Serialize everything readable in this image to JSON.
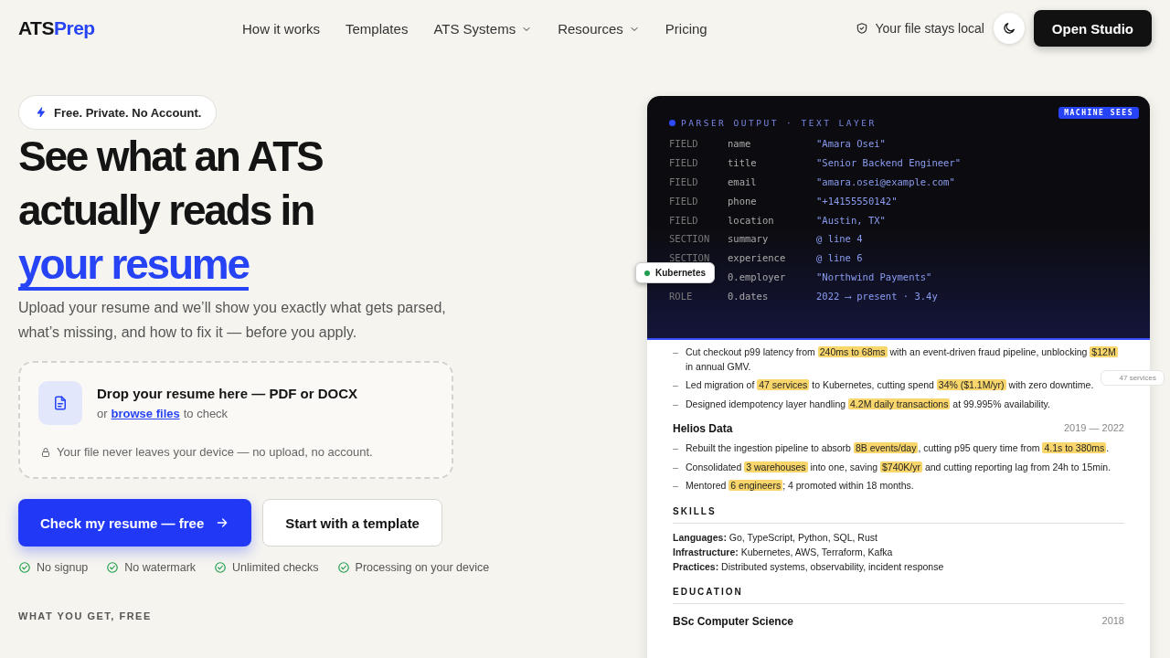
{
  "nav": {
    "logo": {
      "part_1": "ATS",
      "part_2": "Prep"
    },
    "links": [
      {
        "label": "How it works",
        "dropdown": false
      },
      {
        "label": "Templates",
        "dropdown": false
      },
      {
        "label": "ATS Systems",
        "dropdown": true
      },
      {
        "label": "Resources",
        "dropdown": true
      },
      {
        "label": "Pricing",
        "dropdown": false
      }
    ],
    "local_note": "Your file stays local",
    "cta": "Open Studio"
  },
  "hero": {
    "badge": "Free. Private. No Account.",
    "headline_lines": [
      "See what an ATS",
      "actually reads in"
    ],
    "headline_accent": "your resume",
    "subtitle": "Upload your resume and we’ll show you exactly what gets parsed, what’s missing, and how to fix it — before you apply.",
    "dropzone": {
      "title": "Drop your resume here — PDF or DOCX",
      "prefix": "or",
      "link": "browse files",
      "suffix": "to check",
      "privacy": "Your file never leaves your device — no upload, no account."
    },
    "primary_button": "Check my resume — free",
    "secondary_button": "Start with a template",
    "perks": [
      "No signup",
      "No watermark",
      "Unlimited checks",
      "Processing on your device"
    ],
    "section_label": "WHAT YOU GET, FREE"
  },
  "preview": {
    "header": "PARSER OUTPUT · TEXT LAYER",
    "tag": "MACHINE SEES",
    "rows": [
      {
        "kind": "FIELD",
        "key": "name",
        "value": "\"Amara Osei\""
      },
      {
        "kind": "FIELD",
        "key": "title",
        "value": "\"Senior Backend Engineer\""
      },
      {
        "kind": "FIELD",
        "key": "email",
        "value": "\"amara.osei@example.com\""
      },
      {
        "kind": "FIELD",
        "key": "phone",
        "value": "\"+14155550142\""
      },
      {
        "kind": "FIELD",
        "key": "location",
        "value": "\"Austin, TX\""
      },
      {
        "kind": "SECTION",
        "key": "summary",
        "value": "@ line 4"
      },
      {
        "kind": "SECTION",
        "key": "experience",
        "value": "@ line 6"
      },
      {
        "key": "0.employer",
        "value": "\"Northwind Payments\""
      },
      {
        "kind": "ROLE",
        "key": "0.dates",
        "value": "2022 ⟶ present · 3.4y"
      }
    ],
    "chip": "Kubernetes",
    "ghost_chip": "47 services",
    "bullets_1": [
      [
        {
          "text": "Cut checkout p99 latency from ",
          "highlight": false
        },
        {
          "text": "240ms to 68ms",
          "highlight": true
        },
        {
          "text": " with an event-driven fraud pipeline, unblocking ",
          "highlight": false
        },
        {
          "text": "$12M",
          "highlight": true
        },
        {
          "text": " in annual GMV.",
          "highlight": false
        }
      ],
      [
        {
          "text": "Led migration of ",
          "highlight": false
        },
        {
          "text": "47 services",
          "highlight": true
        },
        {
          "text": " to Kubernetes, cutting spend ",
          "highlight": false
        },
        {
          "text": "34% ($1.1M/yr)",
          "highlight": true
        },
        {
          "text": " with zero downtime.",
          "highlight": false
        }
      ],
      [
        {
          "text": "Designed idempotency layer handling ",
          "highlight": false
        },
        {
          "text": "4.2M daily transactions",
          "highlight": true
        },
        {
          "text": " at 99.995% availability.",
          "highlight": false
        }
      ]
    ],
    "job_2": {
      "company": "Helios Data",
      "dates": "2019 — 2022"
    },
    "bullets_2": [
      [
        {
          "text": "Rebuilt the ingestion pipeline to absorb ",
          "highlight": false
        },
        {
          "text": "8B events/day",
          "highlight": true
        },
        {
          "text": ", cutting p95 query time from ",
          "highlight": false
        },
        {
          "text": "4.1s to 380ms",
          "highlight": true
        },
        {
          "text": ".",
          "highlight": false
        }
      ],
      [
        {
          "text": "Consolidated ",
          "highlight": false
        },
        {
          "text": "3 warehouses",
          "highlight": true
        },
        {
          "text": " into one, saving ",
          "highlight": false
        },
        {
          "text": "$740K/yr",
          "highlight": true
        },
        {
          "text": " and cutting reporting lag from 24h to 15min.",
          "highlight": false
        }
      ],
      [
        {
          "text": "Mentored ",
          "highlight": false
        },
        {
          "text": "6 engineers",
          "highlight": true
        },
        {
          "text": "; 4 promoted within 18 months.",
          "highlight": false
        }
      ]
    ],
    "skills_title": "SKILLS",
    "skills": [
      "**Languages:** Go, TypeScript, Python, SQL, Rust",
      "**Infrastructure:** Kubernetes, AWS, Terraform, Kafka",
      "**Practices:** Distributed systems, observability, incident response"
    ],
    "education_title": "EDUCATION",
    "education": {
      "degree": "BSc Computer Science",
      "year": "2018"
    }
  }
}
